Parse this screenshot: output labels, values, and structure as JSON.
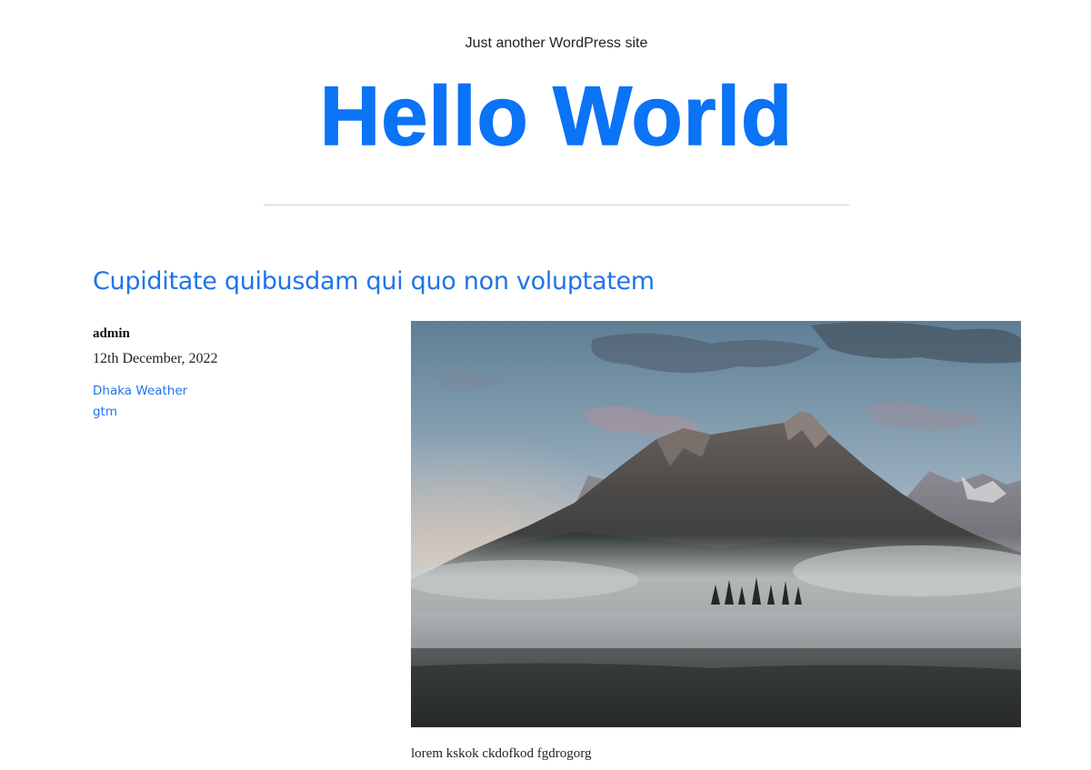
{
  "header": {
    "tagline": "Just another WordPress site",
    "site_title": "Hello World"
  },
  "post": {
    "title": "Cupiditate quibusdam qui quo non voluptatem",
    "author": "admin",
    "date": "12th December, 2022",
    "tags": [
      "Dhaka Weather",
      "gtm"
    ],
    "excerpt": "lorem kskok ckdofkod fgdrogorg"
  },
  "colors": {
    "accent": "#0b73f5",
    "link": "#1f74e8",
    "divider": "#cccccc"
  }
}
